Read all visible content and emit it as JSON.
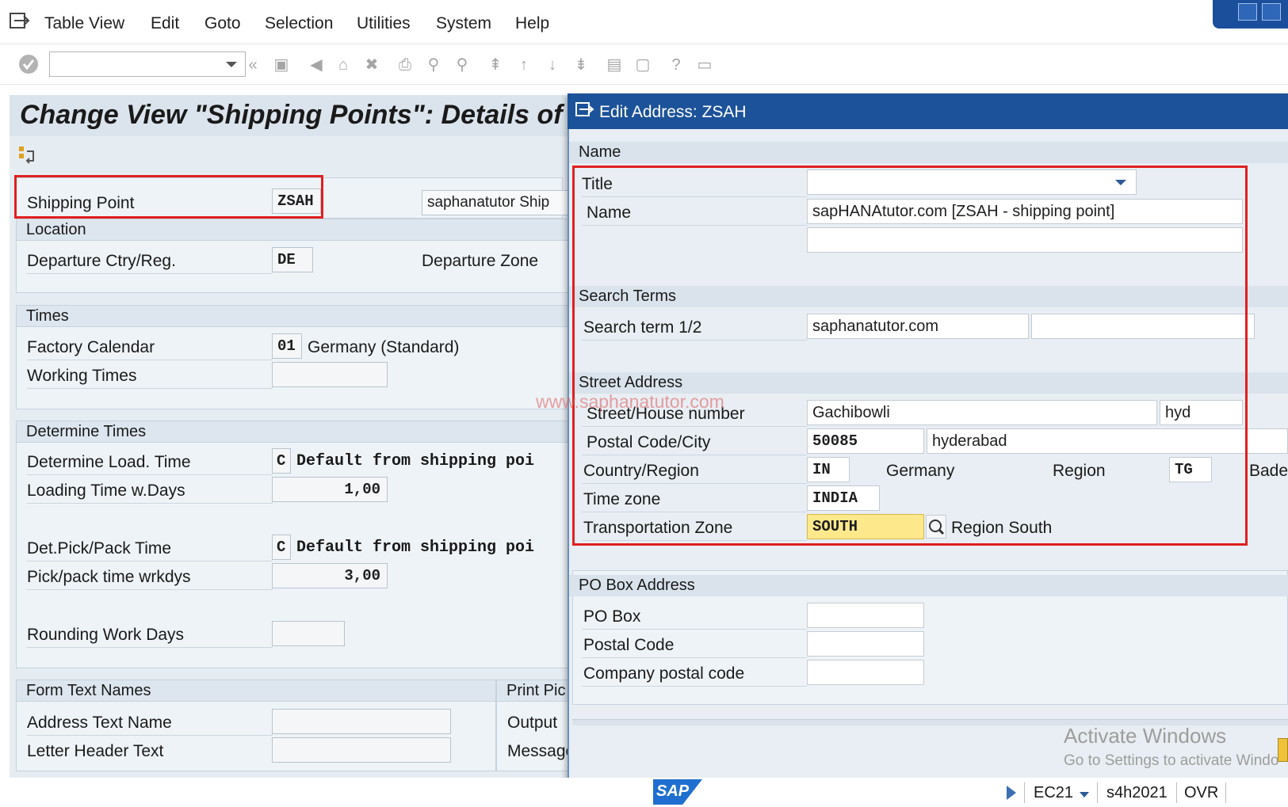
{
  "menu": {
    "items": [
      "Table View",
      "Edit",
      "Goto",
      "Selection",
      "Utilities",
      "System",
      "Help"
    ]
  },
  "toolbar": {
    "command_field_value": ""
  },
  "main": {
    "title": "Change View \"Shipping Points\": Details of",
    "shipping_point": {
      "label": "Shipping Point",
      "value": "ZSAH",
      "description": "saphanatutor  Ship"
    },
    "location": {
      "heading": "Location",
      "departure_ctry_label": "Departure Ctry/Reg.",
      "departure_ctry_value": "DE",
      "departure_zone_label": "Departure Zone"
    },
    "times": {
      "heading": "Times",
      "factory_calendar_label": "Factory Calendar",
      "factory_calendar_value": "01",
      "factory_calendar_text": "Germany (Standard)",
      "working_times_label": "Working Times",
      "working_times_value": ""
    },
    "determine_times": {
      "heading": "Determine Times",
      "load_time_label": "Determine Load. Time",
      "load_time_code": "C",
      "load_time_text": "Default from shipping poi",
      "loading_days_label": "Loading Time w.Days",
      "loading_days_value": "1,00",
      "pick_pack_label": "Det.Pick/Pack Time",
      "pick_pack_code": "C",
      "pick_pack_text": "Default from shipping poi",
      "pick_pack_days_label": "Pick/pack time wrkdys",
      "pick_pack_days_value": "3,00",
      "rounding_label": "Rounding Work Days",
      "rounding_value": ""
    },
    "form_text": {
      "heading": "Form Text Names",
      "print_heading": "Print Pic",
      "address_text_label": "Address Text Name",
      "letter_header_label": "Letter Header Text",
      "output_label": "Output",
      "message_label": "Message"
    }
  },
  "dialog": {
    "title": "Edit Address:  ZSAH",
    "name_section": {
      "heading": "Name",
      "title_label": "Title",
      "title_value": "",
      "name_label": "Name",
      "name_value": "sapHANAtutor.com [ZSAH - shipping point]",
      "name2_value": ""
    },
    "search_section": {
      "heading": "Search Terms",
      "search_label": "Search term 1/2",
      "search1": "saphanatutor.com",
      "search2": ""
    },
    "street_section": {
      "heading": "Street Address",
      "street_label": "Street/House number",
      "street_value": "Gachibowli",
      "house_value": "hyd",
      "postal_label": "Postal Code/City",
      "postal_value": "50085",
      "city_value": "hyderabad",
      "country_label": "Country/Region",
      "country_value": "IN",
      "country_text": "Germany",
      "region_label": "Region",
      "region_value": "TG",
      "region_text_cut": "Bade",
      "timezone_label": "Time zone",
      "timezone_value": "INDIA",
      "transport_label": "Transportation Zone",
      "transport_value": "SOUTH",
      "transport_text": "Region South"
    },
    "po_section": {
      "heading": "PO Box Address",
      "po_box_label": "PO Box",
      "postal_code_label": "Postal Code",
      "company_postal_label": "Company postal code"
    }
  },
  "watermark": "www.saphanatutor.com",
  "activate_windows": {
    "line1": "Activate Windows",
    "line2": "Go to Settings to activate Windo"
  },
  "statusbar": {
    "logo": "SAP",
    "system": "EC21",
    "server": "s4h2021",
    "mode": "OVR"
  },
  "colors": {
    "dialog_title_bg": "#1c5299",
    "highlight_red": "#e02020",
    "focused_field": "#fde98c"
  }
}
